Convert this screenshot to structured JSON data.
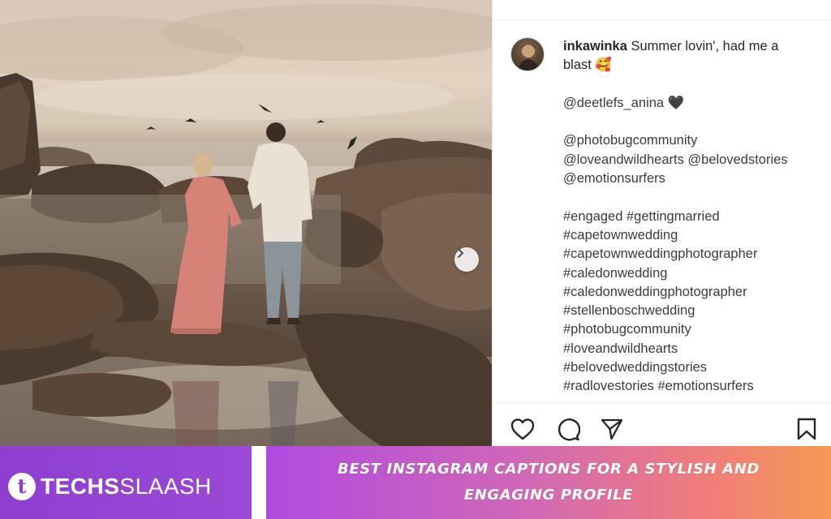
{
  "post": {
    "username": "inkawinka",
    "caption_lines": [
      "Summer lovin', had me a",
      "blast 🥰"
    ],
    "mention_1": "@deetlefs_anina",
    "heart": "🖤",
    "mentions": [
      "@photobugcommunity",
      "@loveandwildhearts @belovedstories",
      "@emotionsurfers"
    ],
    "hashtags": [
      "#engaged #gettingmarried",
      "#capetownwedding",
      "#capetownweddingphotographer",
      "#caledonwedding",
      "#caledonweddingphotographer",
      "#stellenboschwedding",
      "#photobugcommunity",
      "#loveandwildhearts",
      "#belovedweddingstories",
      "#radlovestories #emotionsurfers"
    ]
  },
  "actions": {
    "like_icon": "heart-outline-icon",
    "comment_icon": "comment-bubble-icon",
    "share_icon": "paper-plane-icon",
    "save_icon": "bookmark-icon"
  },
  "banner": {
    "brand_logo_letter": "t",
    "brand_bold": "TECHS",
    "brand_light": "SLAASH",
    "headline": "BEST INSTAGRAM CAPTIONS FOR A STYLISH AND ENGAGING PROFILE"
  },
  "colors": {
    "brand_purple": "#8e3fd0",
    "headline_gradient_start": "#b04be0",
    "headline_gradient_end": "#f59a55",
    "text_dark": "#262626"
  }
}
